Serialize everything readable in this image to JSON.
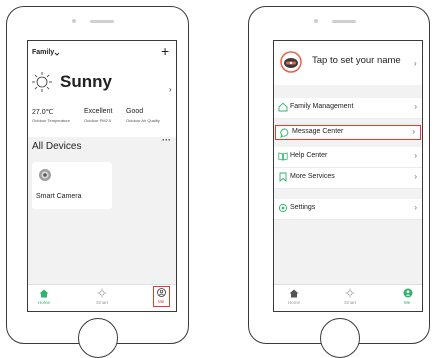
{
  "left": {
    "header": {
      "family_label": "Family",
      "add_icon": "plus-icon"
    },
    "weather": {
      "condition": "Sunny",
      "temperature": "27.0℃",
      "temperature_label": "Outdoor Temperature",
      "pm25": "Excellent",
      "pm25_label": "Outdoor PM2.5",
      "air_quality": "Good",
      "air_quality_label": "Outdoor Air Quality"
    },
    "devices": {
      "title": "All Devices",
      "more_icon": "ellipsis-icon",
      "items": [
        {
          "name": "Smart Camera",
          "icon": "camera-icon"
        }
      ]
    },
    "tabs": [
      {
        "label": "Home",
        "icon": "home-icon",
        "active": true
      },
      {
        "label": "Smart",
        "icon": "sun-icon",
        "active": false
      },
      {
        "label": "Me",
        "icon": "user-icon",
        "active": false,
        "highlighted": true
      }
    ]
  },
  "right": {
    "profile": {
      "prompt": "Tap to set your name",
      "avatar_icon": "avatar-icon"
    },
    "menu": [
      {
        "label": "Family Management",
        "icon": "house-outline-icon"
      },
      {
        "label": "Message Center",
        "icon": "chat-icon",
        "highlighted": true
      },
      {
        "label": "Help Center",
        "icon": "book-icon"
      },
      {
        "label": "More Services",
        "icon": "bookmark-icon"
      },
      {
        "label": "Settings",
        "icon": "gear-icon"
      }
    ],
    "tabs": [
      {
        "label": "Home",
        "icon": "home-icon",
        "active": false
      },
      {
        "label": "Smart",
        "icon": "sun-icon",
        "active": false
      },
      {
        "label": "Me",
        "icon": "user-icon",
        "active": true
      }
    ]
  },
  "colors": {
    "accent_green": "#2db36b",
    "highlight_red": "#e53935",
    "frame": "#3a3a3a"
  }
}
